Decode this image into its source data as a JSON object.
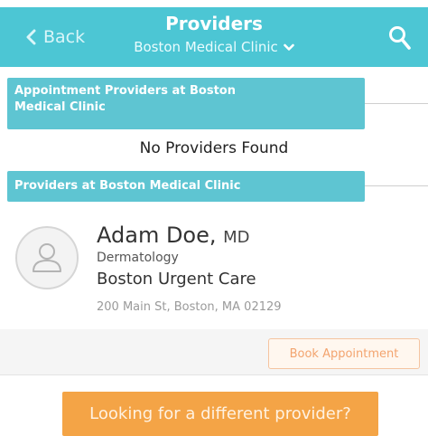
{
  "header": {
    "back_label": "Back",
    "title": "Providers",
    "clinic_selector": "Boston Medical Clinic"
  },
  "sections": {
    "appointment_providers_title_line1": "Appointment Providers at Boston",
    "appointment_providers_title_line2": "Medical Clinic",
    "empty_message": "No Providers Found",
    "providers_title": "Providers at Boston Medical Clinic"
  },
  "provider": {
    "name": "Adam Doe,",
    "credential": "MD",
    "specialty": "Dermatology",
    "location": "Boston Urgent Care",
    "address": "200 Main St, Boston, MA 02129",
    "book_label": "Book Appointment"
  },
  "footer": {
    "different_provider_label": "Looking for a different provider?"
  },
  "colors": {
    "header_bg": "#4cc6d4",
    "banner_bg": "#5ec5d2",
    "cta_orange": "#f4a446"
  }
}
